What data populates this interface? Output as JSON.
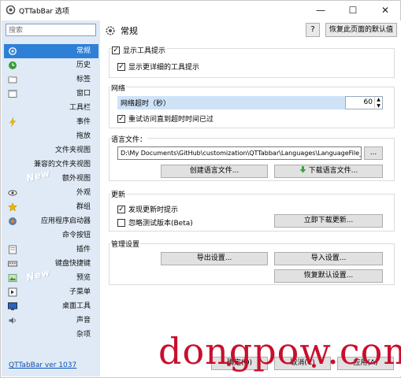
{
  "window": {
    "title": "QTTabBar 选项",
    "min": "—",
    "max": "☐",
    "close": "✕"
  },
  "sidebar": {
    "search_placeholder": "搜索",
    "items": [
      {
        "label": "常规",
        "icon": "gear-icon"
      },
      {
        "label": "历史",
        "icon": "history-icon"
      },
      {
        "label": "标签",
        "icon": "tab-icon"
      },
      {
        "label": "窗口",
        "icon": "window-icon"
      },
      {
        "label": "工具栏",
        "icon": ""
      },
      {
        "label": "事件",
        "icon": "lightning-icon"
      },
      {
        "label": "拖放",
        "icon": ""
      },
      {
        "label": "文件夹视图",
        "icon": ""
      },
      {
        "label": "兼容的文件夹视图",
        "icon": ""
      },
      {
        "label": "额外视图",
        "icon": ""
      },
      {
        "label": "外观",
        "icon": "eye-icon"
      },
      {
        "label": "群组",
        "icon": "star-icon"
      },
      {
        "label": "应用程序启动器",
        "icon": "launcher-icon"
      },
      {
        "label": "命令按钮",
        "icon": ""
      },
      {
        "label": "插件",
        "icon": "plugin-icon"
      },
      {
        "label": "键盘快捷键",
        "icon": "keyboard-icon"
      },
      {
        "label": "预览",
        "icon": "preview-icon"
      },
      {
        "label": "子菜单",
        "icon": "submenu-icon"
      },
      {
        "label": "桌面工具",
        "icon": "desktop-icon"
      },
      {
        "label": "声音",
        "icon": "speaker-icon"
      },
      {
        "label": "杂项",
        "icon": ""
      }
    ],
    "new_badge": "New",
    "version_link": "QTTabBar ver 1037"
  },
  "main": {
    "title": "常规",
    "help_label": "?",
    "restore_label": "恢复此页面的默认值",
    "tooltips": {
      "show": "显示工具提示",
      "detailed": "显示更详细的工具提示"
    },
    "network": {
      "header": "网络",
      "timeout_label": "网络超时（秒）",
      "timeout_value": "60",
      "retry": "重试访问直到超时时间已过"
    },
    "language": {
      "header": "语言文件：",
      "path": "D:\\My Documents\\GitHub\\customization\\QTTabbar\\Languages\\LanguageFile_zh",
      "browse": "...",
      "create": "创建语言文件...",
      "download": "下载语言文件..."
    },
    "update": {
      "header": "更新",
      "notify": "发现更新时提示",
      "ignore_beta": "忽略测试版本(Beta)",
      "download_now": "立即下载更新..."
    },
    "manage": {
      "header": "管理设置",
      "export": "导出设置...",
      "import": "导入设置...",
      "reset": "恢复默认设置..."
    }
  },
  "footer": {
    "ok": "确定(O)",
    "cancel": "取消(C)",
    "apply": "应用(A)"
  },
  "watermark": "dongpow.com",
  "colors": {
    "selected": "#2e7fd6",
    "sidebar_bg": "#dfeaf6",
    "watermark": "#c8102e"
  }
}
